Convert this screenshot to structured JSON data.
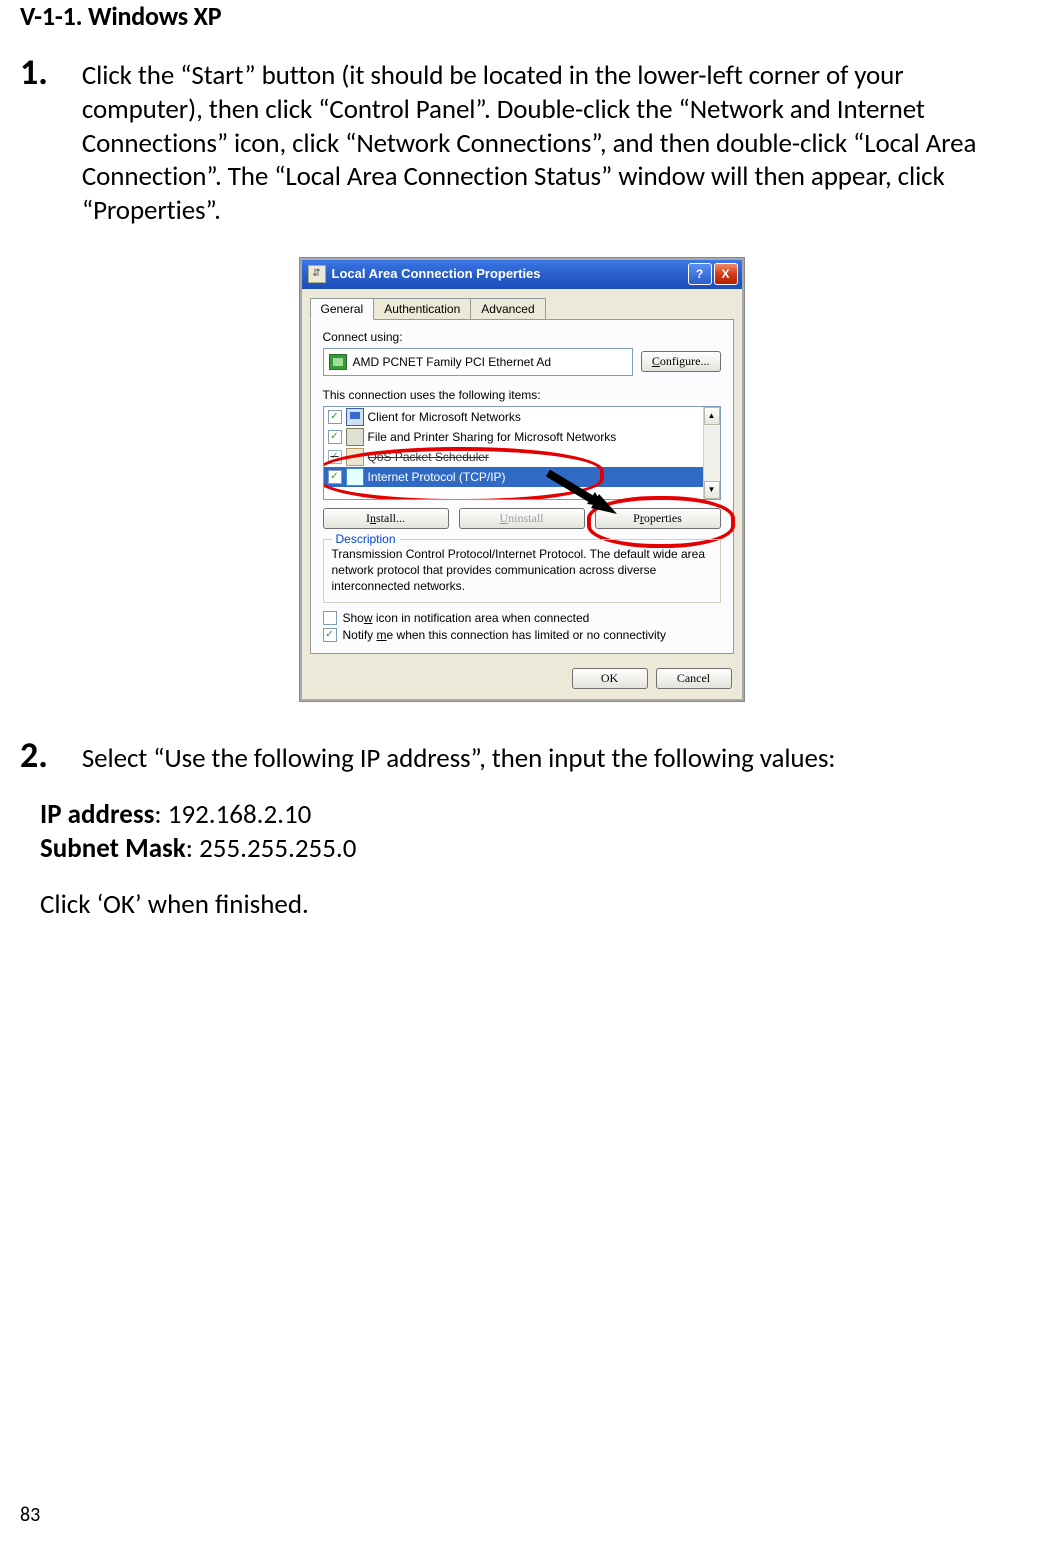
{
  "doc": {
    "section_heading": "V-1-1.    Windows XP",
    "steps": {
      "1": {
        "num": "1.",
        "text": "Click the “Start” button (it should be located in the lower-left corner of your computer), then click “Control Panel”. Double-click the “Network and Internet Connections” icon, click “Network Connections”, and then double-click “Local Area Connection”. The “Local Area Connection Status” window will then appear, click “Properties”."
      },
      "2": {
        "num": "2.",
        "text": "Select “Use the following IP address”, then input the following values:",
        "ip_label": "IP address",
        "ip_value": ": 192.168.2.10",
        "mask_label": "Subnet Mask",
        "mask_value": ": 255.255.255.0",
        "tail": "Click ‘OK’ when finished."
      }
    },
    "page_number": "83"
  },
  "xp": {
    "title": "Local Area Connection Properties",
    "help": "?",
    "close": "X",
    "tabs": {
      "general": "General",
      "auth": "Authentication",
      "adv": "Advanced"
    },
    "connect_using_label": "Connect using:",
    "adapter": "AMD PCNET Family PCI Ethernet Ad",
    "configure": "Configure...",
    "items_label": "This connection uses the following items:",
    "items": {
      "0": "Client for Microsoft Networks",
      "1": "File and Printer Sharing for Microsoft Networks",
      "2": "QoS Packet Scheduler",
      "3": "Internet Protocol (TCP/IP)"
    },
    "install": "Install...",
    "uninstall": "Uninstall",
    "properties": "Properties",
    "desc_legend": "Description",
    "desc_text": "Transmission Control Protocol/Internet Protocol. The default wide area network protocol that provides communication across diverse interconnected networks.",
    "show_icon": "Show icon in notification area when connected",
    "notify": "Notify me when this connection has limited or no connectivity",
    "ok": "OK",
    "cancel": "Cancel"
  }
}
